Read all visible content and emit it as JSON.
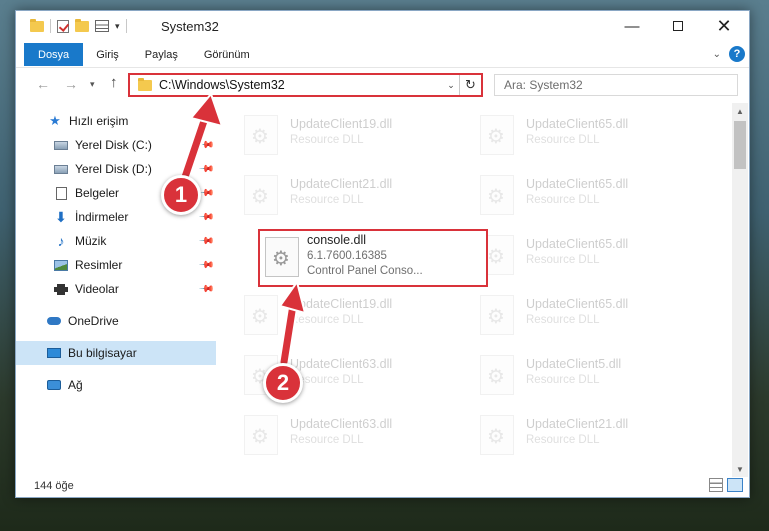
{
  "window": {
    "title": "System32",
    "controls": {
      "minimize": "—",
      "maximize": "",
      "close": "✕"
    }
  },
  "ribbon": {
    "tabs": [
      "Dosya",
      "Giriş",
      "Paylaş",
      "Görünüm"
    ],
    "help": "?"
  },
  "navigation": {
    "back": "←",
    "forward": "→",
    "recent": "▾",
    "up": "↑",
    "address": "C:\\Windows\\System32",
    "refresh": "↻",
    "search_placeholder": "Ara: System32"
  },
  "sidebar": {
    "items": [
      {
        "label": "Hızlı erişim",
        "icon": "star-icon"
      },
      {
        "label": "Yerel Disk (C:)",
        "icon": "drive-icon",
        "pinned": true
      },
      {
        "label": "Yerel Disk (D:)",
        "icon": "drive-icon",
        "pinned": true
      },
      {
        "label": "Belgeler",
        "icon": "document-icon",
        "pinned": true
      },
      {
        "label": "İndirmeler",
        "icon": "download-icon",
        "pinned": true
      },
      {
        "label": "Müzik",
        "icon": "music-icon",
        "pinned": true
      },
      {
        "label": "Resimler",
        "icon": "picture-icon",
        "pinned": true
      },
      {
        "label": "Videolar",
        "icon": "video-icon",
        "pinned": true
      },
      {
        "label": "OneDrive",
        "icon": "cloud-icon"
      },
      {
        "label": "Bu bilgisayar",
        "icon": "computer-icon",
        "selected": true
      },
      {
        "label": "Ağ",
        "icon": "network-icon"
      }
    ]
  },
  "files": {
    "left": [
      {
        "name": "UpdateClient19.dll",
        "type": "Resource DLL"
      },
      {
        "name": "UpdateClient21.dll",
        "type": "Resource DLL"
      },
      {
        "name": "UpdateClient19.dll",
        "type": "Resource DLL"
      },
      {
        "name": "UpdateClient63.dll",
        "type": "Resource DLL"
      },
      {
        "name": "UpdateClient63.dll",
        "type": "Resource DLL"
      }
    ],
    "right": [
      {
        "name": "UpdateClient65.dll",
        "type": "Resource DLL"
      },
      {
        "name": "UpdateClient65.dll",
        "type": "Resource DLL"
      },
      {
        "name": "UpdateClient65.dll",
        "type": "Resource DLL"
      },
      {
        "name": "UpdateClient65.dll",
        "type": "Resource DLL"
      },
      {
        "name": "UpdateClient5.dll",
        "type": "Resource DLL"
      },
      {
        "name": "UpdateClient21.dll",
        "type": "Resource DLL"
      }
    ],
    "highlighted": {
      "name": "console.dll",
      "version": "6.1.7600.16385",
      "description": "Control Panel Conso..."
    }
  },
  "status": {
    "item_count": "144 öğe"
  },
  "annotations": {
    "step1": "1",
    "step2": "2",
    "color": "#d9323a"
  }
}
